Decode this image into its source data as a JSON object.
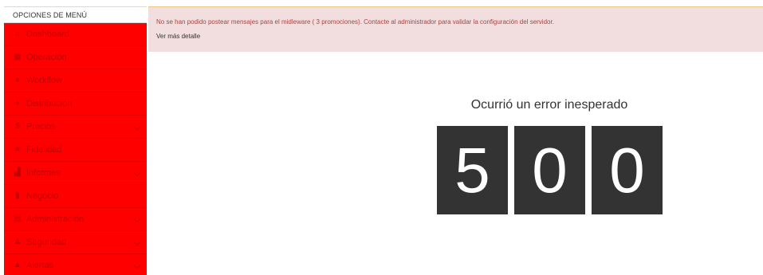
{
  "sidebar": {
    "header": "OPCIONES DE MENÚ",
    "items": [
      {
        "label": "Dashboard",
        "icon": "dashboard-icon",
        "glyph": "⌂",
        "chevron": false
      },
      {
        "label": "Operación",
        "icon": "grid-icon",
        "glyph": "▦",
        "chevron": false
      },
      {
        "label": "Workflow",
        "icon": "info-circle-icon",
        "glyph": "●",
        "chevron": false
      },
      {
        "label": "Distribución",
        "icon": "map-marker-icon",
        "glyph": "♦",
        "chevron": false
      },
      {
        "label": "Precios",
        "icon": "dollar-icon",
        "glyph": "$",
        "chevron": true
      },
      {
        "label": "Fidelidad",
        "icon": "star-icon",
        "glyph": "★",
        "chevron": false
      },
      {
        "label": "Informes",
        "icon": "chart-icon",
        "glyph": "▟",
        "chevron": true
      },
      {
        "label": "Negocio",
        "icon": "book-icon",
        "glyph": "▮",
        "chevron": false
      },
      {
        "label": "Administración",
        "icon": "calendar-icon",
        "glyph": "▤",
        "chevron": true
      },
      {
        "label": "Seguridad",
        "icon": "users-icon",
        "glyph": "♟",
        "chevron": true
      },
      {
        "label": "Alertas",
        "icon": "bell-icon",
        "glyph": "▲",
        "chevron": true
      }
    ]
  },
  "alert": {
    "message": "No se han podido postear mensajes para el midleware ( 3 promociones). Contacte al administrador para validar la configuración del servidor.",
    "link": "Ver más detalle"
  },
  "error": {
    "title": "Ocurrió un error inesperado",
    "digits": [
      "5",
      "0",
      "0"
    ]
  },
  "colors": {
    "sidebar_bg": "#ff0000",
    "alert_bg": "#f2dede",
    "alert_text": "#a94442",
    "digit_bg": "#333333"
  }
}
